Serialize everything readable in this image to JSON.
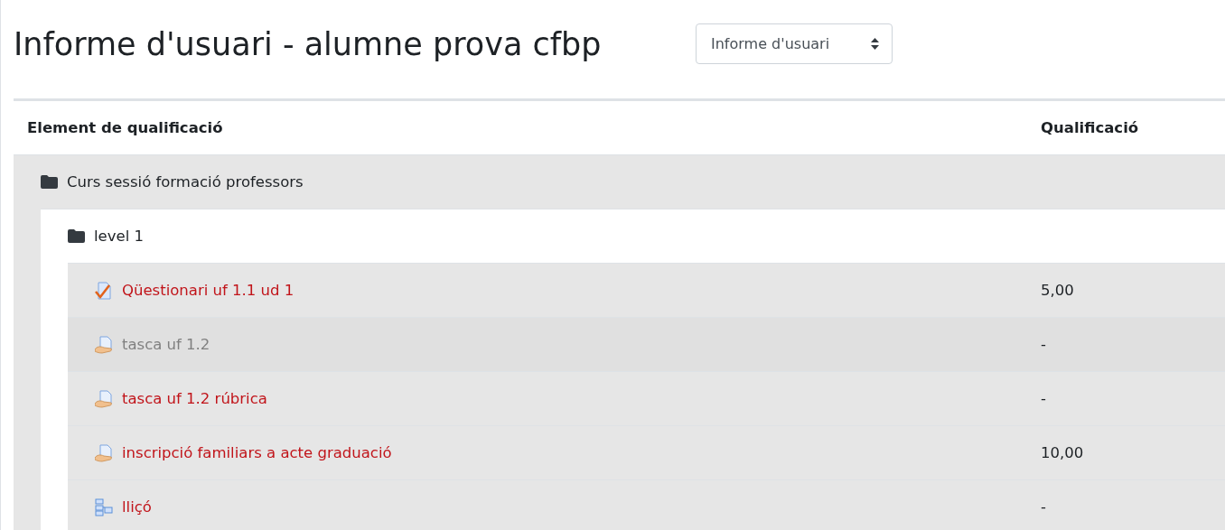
{
  "title": "Informe d'usuari - alumne prova cfbp",
  "report_select": {
    "value": "Informe d'usuari"
  },
  "table": {
    "columns": [
      "Element de qualificació",
      "Qualificació"
    ],
    "category": {
      "name": "Curs sessió formació professors",
      "children": [
        {
          "name": "level 1",
          "items": [
            {
              "name": "Qüestionari uf 1.1 ud 1",
              "kind": "quiz",
              "hidden": false,
              "grade": "5,00"
            },
            {
              "name": "tasca uf 1.2",
              "kind": "assignment",
              "hidden": true,
              "grade": "-"
            },
            {
              "name": "tasca uf 1.2 rúbrica",
              "kind": "assignment",
              "hidden": false,
              "grade": "-"
            },
            {
              "name": "inscripció familiars a acte graduació",
              "kind": "assignment",
              "hidden": false,
              "grade": "10,00"
            },
            {
              "name": "lliçó",
              "kind": "lesson",
              "hidden": false,
              "grade": "-"
            }
          ]
        }
      ]
    }
  }
}
